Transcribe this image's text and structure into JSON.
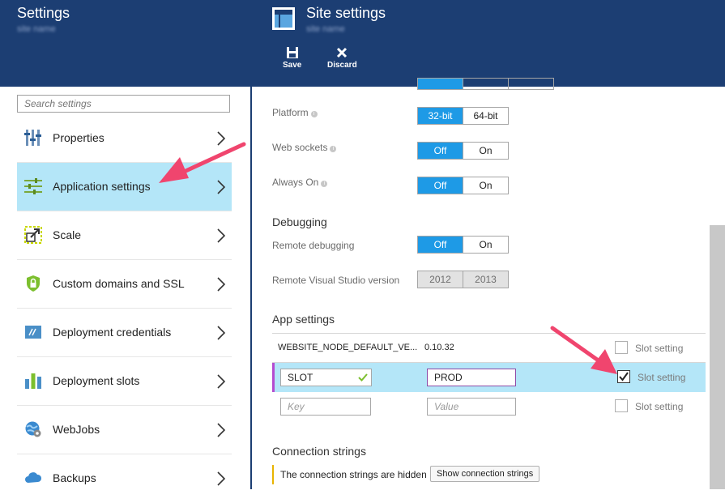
{
  "settings_blade": {
    "title": "Settings",
    "subtitle": "site name",
    "search_placeholder": "Search settings",
    "nav_items": [
      {
        "label": "Properties",
        "icon": "properties-icon"
      },
      {
        "label": "Application settings",
        "icon": "sliders-icon",
        "active": true
      },
      {
        "label": "Scale",
        "icon": "scale-icon"
      },
      {
        "label": "Custom domains and SSL",
        "icon": "shield-lock-icon"
      },
      {
        "label": "Deployment credentials",
        "icon": "credentials-icon"
      },
      {
        "label": "Deployment slots",
        "icon": "slots-icon"
      },
      {
        "label": "WebJobs",
        "icon": "webjobs-icon"
      },
      {
        "label": "Backups",
        "icon": "cloud-icon"
      }
    ]
  },
  "site_blade": {
    "title": "Site settings",
    "subtitle": "site name",
    "toolbar": {
      "save_label": "Save",
      "discard_label": "Discard"
    },
    "platform": {
      "label": "Platform",
      "options": [
        "32-bit",
        "64-bit"
      ],
      "selected": "32-bit"
    },
    "web_sockets": {
      "label": "Web sockets",
      "options": [
        "Off",
        "On"
      ],
      "selected": "Off"
    },
    "always_on": {
      "label": "Always On",
      "options": [
        "Off",
        "On"
      ],
      "selected": "Off"
    },
    "debugging": {
      "heading": "Debugging",
      "remote_debugging": {
        "label": "Remote debugging",
        "options": [
          "Off",
          "On"
        ],
        "selected": "Off"
      },
      "remote_vs_version": {
        "label": "Remote Visual Studio version",
        "options": [
          "2012",
          "2013"
        ]
      }
    },
    "app_settings": {
      "heading": "App settings",
      "slot_setting_label": "Slot setting",
      "rows": [
        {
          "key": "WEBSITE_NODE_DEFAULT_VE...",
          "value": "0.10.32",
          "slot": false
        },
        {
          "key": "SLOT",
          "value": "PROD",
          "slot": true
        }
      ],
      "new_row": {
        "key_placeholder": "Key",
        "value_placeholder": "Value"
      }
    },
    "connection_strings": {
      "heading": "Connection strings",
      "notice": "The connection strings are hidden",
      "show_button": "Show connection strings"
    }
  },
  "colors": {
    "header": "#1c3e73",
    "active_row": "#b4e6f8",
    "toggle_on": "#1e9ae6",
    "annotation_arrow": "#f0456e",
    "notice_border": "#e8b400"
  }
}
